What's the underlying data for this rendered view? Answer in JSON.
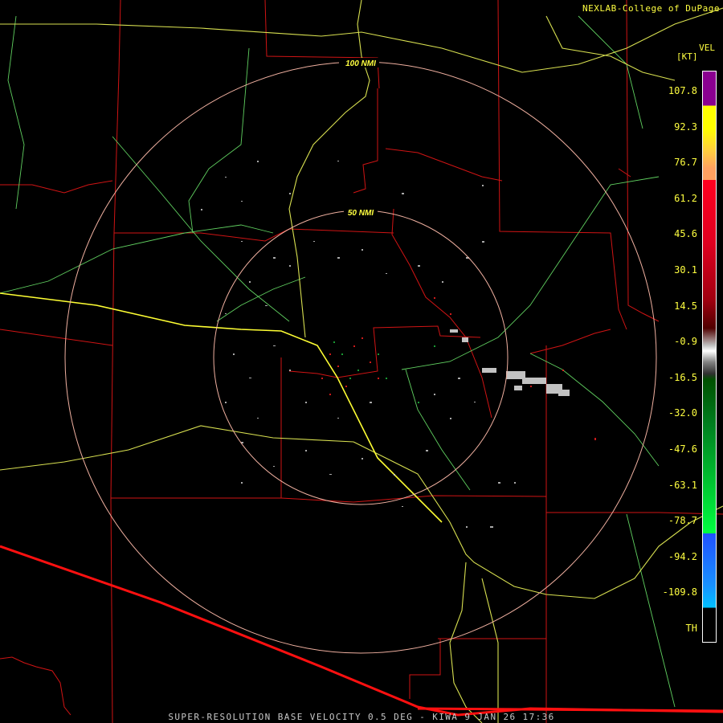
{
  "header": {
    "credit": "NEXLAB-College of DuPage"
  },
  "footer": {
    "caption": "SUPER-RESOLUTION BASE VELOCITY 0.5 DEG - KIWA 9 JAN 26 17:36"
  },
  "range_rings": {
    "inner_label": "50 NMI",
    "outer_label": "100 NMI"
  },
  "legend": {
    "product": "VEL",
    "unit": "[KT]",
    "ticks": [
      "107.8",
      "92.3",
      "76.7",
      "61.2",
      "45.6",
      "30.1",
      "14.5",
      "-0.9",
      "-16.5",
      "-32.0",
      "-47.6",
      "-63.1",
      "-78.7",
      "-94.2",
      "-109.8",
      "TH"
    ],
    "colors": {
      "purple": "#8a0090",
      "yellow": "#ffff00",
      "orange": "#ffa060",
      "red": "#ff0020",
      "dark_red": "#500000",
      "gray": "#c0c0c0",
      "dark_green": "#005000",
      "green": "#00ff40",
      "blue": "#2050ff",
      "cyan": "#00c0ff",
      "background": "#000000"
    }
  },
  "map_colors": {
    "county_lines": "#d01414",
    "highways_major": "#ffff33",
    "highways_minor": "#d8e050",
    "roads": "#60d060",
    "international_border": "#ff1010",
    "range_ring": "#f0b0a0"
  }
}
